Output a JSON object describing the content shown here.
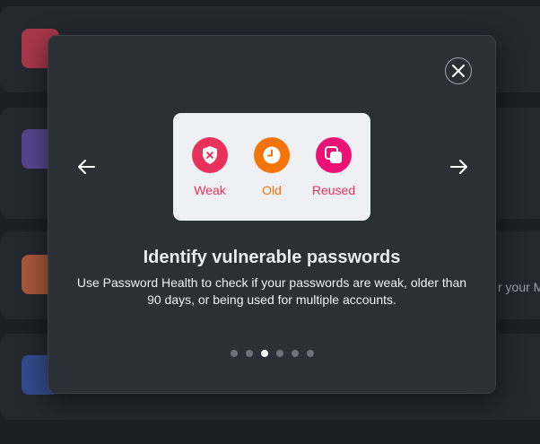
{
  "background": {
    "fragment_text": "r your M",
    "icon_colors": [
      "#a8364b",
      "#56468f",
      "#a8563a",
      "#334a8c"
    ]
  },
  "modal": {
    "close_icon": "close-icon",
    "prev_icon": "arrow-left-icon",
    "next_icon": "arrow-right-icon",
    "features": [
      {
        "label": "Weak",
        "icon": "shield-x-icon",
        "color": "#e8325b"
      },
      {
        "label": "Old",
        "icon": "clock-icon",
        "color": "#f57407"
      },
      {
        "label": "Reused",
        "icon": "copy-icon",
        "color": "#ec1174"
      }
    ],
    "title": "Identify vulnerable passwords",
    "description": "Use Password Health to check if your passwords are weak, older than 90 days, or being used for multiple accounts.",
    "pagination": {
      "total": 6,
      "current": 3
    }
  }
}
